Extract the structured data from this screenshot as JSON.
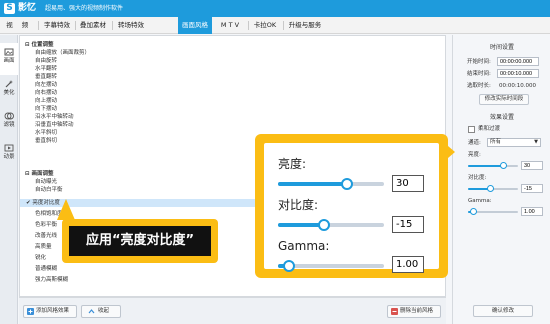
{
  "app": {
    "name": "影忆",
    "slogan": "超易用、强大的视频制作软件",
    "logo_char": "S"
  },
  "menu": {
    "items": [
      "视",
      "频",
      "字幕特效",
      "叠加素材",
      "转场特效",
      "画面风格",
      "M T V",
      "卡拉OK",
      "升级与服务"
    ],
    "active_index": 5
  },
  "left_tabs": [
    {
      "label": "画面",
      "icon": "picture-icon"
    },
    {
      "label": "美化",
      "icon": "magic-wand-icon"
    },
    {
      "label": "滤镜",
      "icon": "filter-icon"
    },
    {
      "label": "动景",
      "icon": "motion-scene-icon"
    }
  ],
  "effect_list": [
    {
      "text": "⊟ 位置调整",
      "group": true
    },
    {
      "text": "自由缩放（画面裁剪）"
    },
    {
      "text": "自由旋转"
    },
    {
      "text": "水平翻转"
    },
    {
      "text": "垂直翻转"
    },
    {
      "text": "向左摆动"
    },
    {
      "text": "向右摆动"
    },
    {
      "text": "向上摆动"
    },
    {
      "text": "向下摆动"
    },
    {
      "text": "沿水平中轴转动"
    },
    {
      "text": "沿垂直中轴转动"
    },
    {
      "text": "水平斜切"
    },
    {
      "text": "垂直斜切"
    },
    {
      "text": "⊟ 画面调整",
      "group": true
    },
    {
      "text": "自动曝光"
    },
    {
      "text": "自动白平衡"
    },
    {
      "text": "✔ 亮度对比度",
      "selected": true
    },
    {
      "text": "色相饱和度"
    },
    {
      "text": "色彩平衡"
    },
    {
      "text": "改善光线"
    },
    {
      "text": "高质量"
    },
    {
      "text": "锐化"
    },
    {
      "text": "普通模糊"
    },
    {
      "text": "强力高斯模糊"
    }
  ],
  "bottom_buttons": {
    "add_style": "添加风格效果",
    "collapse": "收起",
    "delete_style": "删除当前风格"
  },
  "right_panel": {
    "time_section_title": "时间设置",
    "start_label": "开始时间:",
    "start_value": "00:00:00.000",
    "end_label": "结束时间:",
    "end_value": "00:00:10.000",
    "duration_label": "选取时长:",
    "duration_value": "00:00:10.000",
    "modify_time_button": "修改实际时间段",
    "effect_section_title": "效果设置",
    "soft_transition_label": "柔和过渡",
    "channel_label": "通道:",
    "channel_value": "所有",
    "brightness_label": "亮度:",
    "brightness_value": "30",
    "contrast_label": "对比度:",
    "contrast_value": "-15",
    "gamma_label": "Gamma:",
    "gamma_value": "1.00",
    "confirm_button": "确认修改"
  },
  "popup": {
    "brightness_label": "亮度:",
    "brightness_value": "30",
    "brightness_level": 0.65,
    "contrast_label": "对比度:",
    "contrast_value": "-15",
    "contrast_level": 0.43,
    "gamma_label": "Gamma:",
    "gamma_value": "1.00",
    "gamma_level": 0.1
  },
  "callout": {
    "text": "应用“亮度对比度”"
  },
  "colors": {
    "accent": "#1e9bdc",
    "highlight": "#fbbd14",
    "selected_row": "#cfe6fa"
  }
}
